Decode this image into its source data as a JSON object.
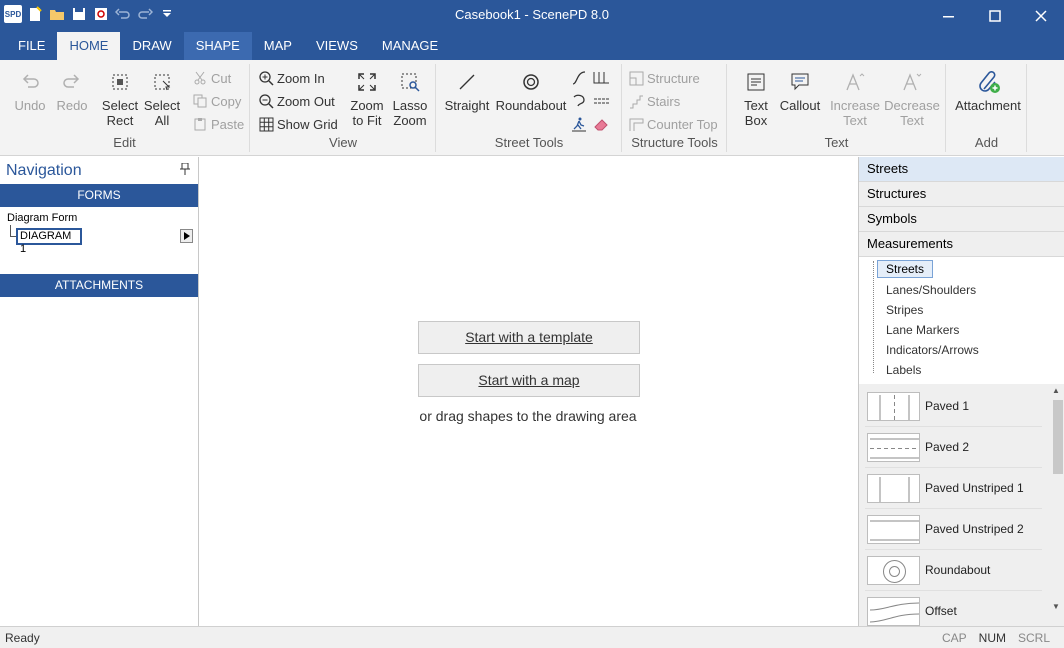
{
  "window": {
    "title": "Casebook1 - ScenePD 8.0",
    "logo_text": "SPD"
  },
  "tabs": [
    "FILE",
    "HOME",
    "DRAW",
    "SHAPE",
    "MAP",
    "VIEWS",
    "MANAGE"
  ],
  "ribbon": {
    "edit": {
      "label": "Edit",
      "undo": "Undo",
      "redo": "Redo",
      "select_rect_1": "Select",
      "select_rect_2": "Rect",
      "select_all_1": "Select",
      "select_all_2": "All",
      "cut": "Cut",
      "copy": "Copy",
      "paste": "Paste"
    },
    "view": {
      "label": "View",
      "zoom_in": "Zoom In",
      "zoom_out": "Zoom Out",
      "show_grid": "Show Grid",
      "zoom_fit_1": "Zoom",
      "zoom_fit_2": "to Fit",
      "lasso_1": "Lasso",
      "lasso_2": "Zoom"
    },
    "street_tools": {
      "label": "Street Tools",
      "straight": "Straight",
      "roundabout": "Roundabout"
    },
    "structure_tools": {
      "label": "Structure Tools",
      "structure": "Structure",
      "stairs": "Stairs",
      "counter_top": "Counter Top"
    },
    "text": {
      "label": "Text",
      "text_box_1": "Text",
      "text_box_2": "Box",
      "callout": "Callout",
      "increase_1": "Increase",
      "increase_2": "Text",
      "decrease_1": "Decrease",
      "decrease_2": "Text"
    },
    "add": {
      "label": "Add",
      "attachment": "Attachment"
    }
  },
  "navigation": {
    "title": "Navigation",
    "forms_header": "FORMS",
    "form_label": "Diagram Form",
    "diagram_item": "DIAGRAM 1",
    "attachments_header": "ATTACHMENTS"
  },
  "canvas": {
    "template_button": "Start with a template",
    "map_button": "Start with a map",
    "drag_text": "or drag shapes to the drawing area"
  },
  "right_panel": {
    "headers": [
      "Streets",
      "Structures",
      "Symbols",
      "Measurements"
    ],
    "tree": [
      "Streets",
      "Lanes/Shoulders",
      "Stripes",
      "Lane Markers",
      "Indicators/Arrows",
      "Labels"
    ],
    "shapes": [
      "Paved 1",
      "Paved 2",
      "Paved Unstriped 1",
      "Paved Unstriped 2",
      "Roundabout",
      "Offset"
    ]
  },
  "status": {
    "left": "Ready",
    "cap": "CAP",
    "num": "NUM",
    "scrl": "SCRL"
  },
  "colors": {
    "accent": "#2b579a",
    "ribbon_bg": "#f3f3f3",
    "disabled": "#a0a0a0"
  }
}
